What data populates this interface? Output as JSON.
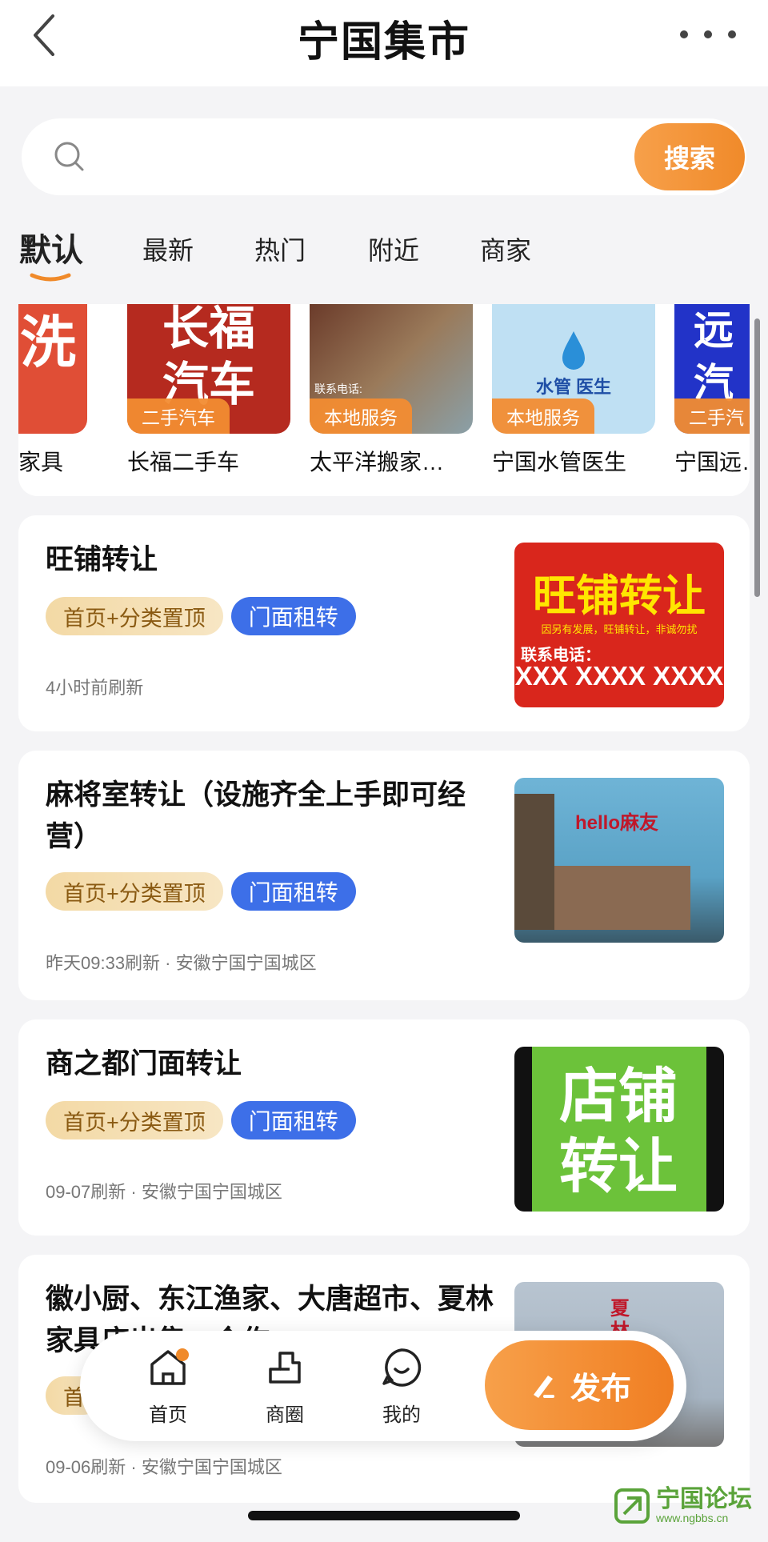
{
  "header": {
    "title": "宁国集市"
  },
  "search": {
    "placeholder": "",
    "button_label": "搜索"
  },
  "tabs": [
    {
      "label": "默认",
      "active": true
    },
    {
      "label": "最新",
      "active": false
    },
    {
      "label": "热门",
      "active": false
    },
    {
      "label": "附近",
      "active": false
    },
    {
      "label": "商家",
      "active": false
    }
  ],
  "categories": [
    {
      "name": "家具",
      "badge": "",
      "thumb_text": "洗"
    },
    {
      "name": "长福二手车",
      "badge": "二手汽车",
      "thumb_text": "长福汽车"
    },
    {
      "name": "太平洋搬家…",
      "badge": "本地服务",
      "thumb_text": "联系电话:"
    },
    {
      "name": "宁国水管医生",
      "badge": "本地服务",
      "thumb_text": "水管 医生"
    },
    {
      "name": "宁国远…",
      "badge": "二手汽",
      "thumb_text": "远汽"
    }
  ],
  "listings": [
    {
      "title": "旺铺转让",
      "tag_top": "首页+分类置顶",
      "tag_category": "门面租转",
      "meta": "4小时前刷新",
      "image_text": "旺铺转让",
      "image_sub": "因另有发展，旺铺转让，非诚勿扰",
      "image_phone_label": "联系电话：",
      "image_phone": "XXX XXXX XXXX"
    },
    {
      "title": "麻将室转让（设施齐全上手即可经营）",
      "tag_top": "首页+分类置顶",
      "tag_category": "门面租转",
      "meta": "昨天09:33刷新 · 安徽宁国宁国城区",
      "image_text": "hello麻友"
    },
    {
      "title": "商之都门面转让",
      "tag_top": "首页+分类置顶",
      "tag_category": "门面租转",
      "meta": "09-07刷新 · 安徽宁国宁国城区",
      "image_text": "店铺转让"
    },
    {
      "title": "徽小厨、东江渔家、大唐超市、夏林家具店出售、合作",
      "tag_top": "首",
      "tag_category": "",
      "meta": "09-06刷新 · 安徽宁国宁国城区",
      "image_text": "夏林办公"
    }
  ],
  "bottom_nav": {
    "items": [
      {
        "label": "首页",
        "icon": "home-icon"
      },
      {
        "label": "商圈",
        "icon": "shop-circle-icon"
      },
      {
        "label": "我的",
        "icon": "profile-icon"
      }
    ],
    "publish_label": "发布"
  },
  "watermark": {
    "name": "宁国论坛",
    "url": "www.ngbbs.cn"
  },
  "colors": {
    "accent": "#f08a2a",
    "tag_blue": "#3d6fe8",
    "tag_gold": "#f3d9a5"
  }
}
